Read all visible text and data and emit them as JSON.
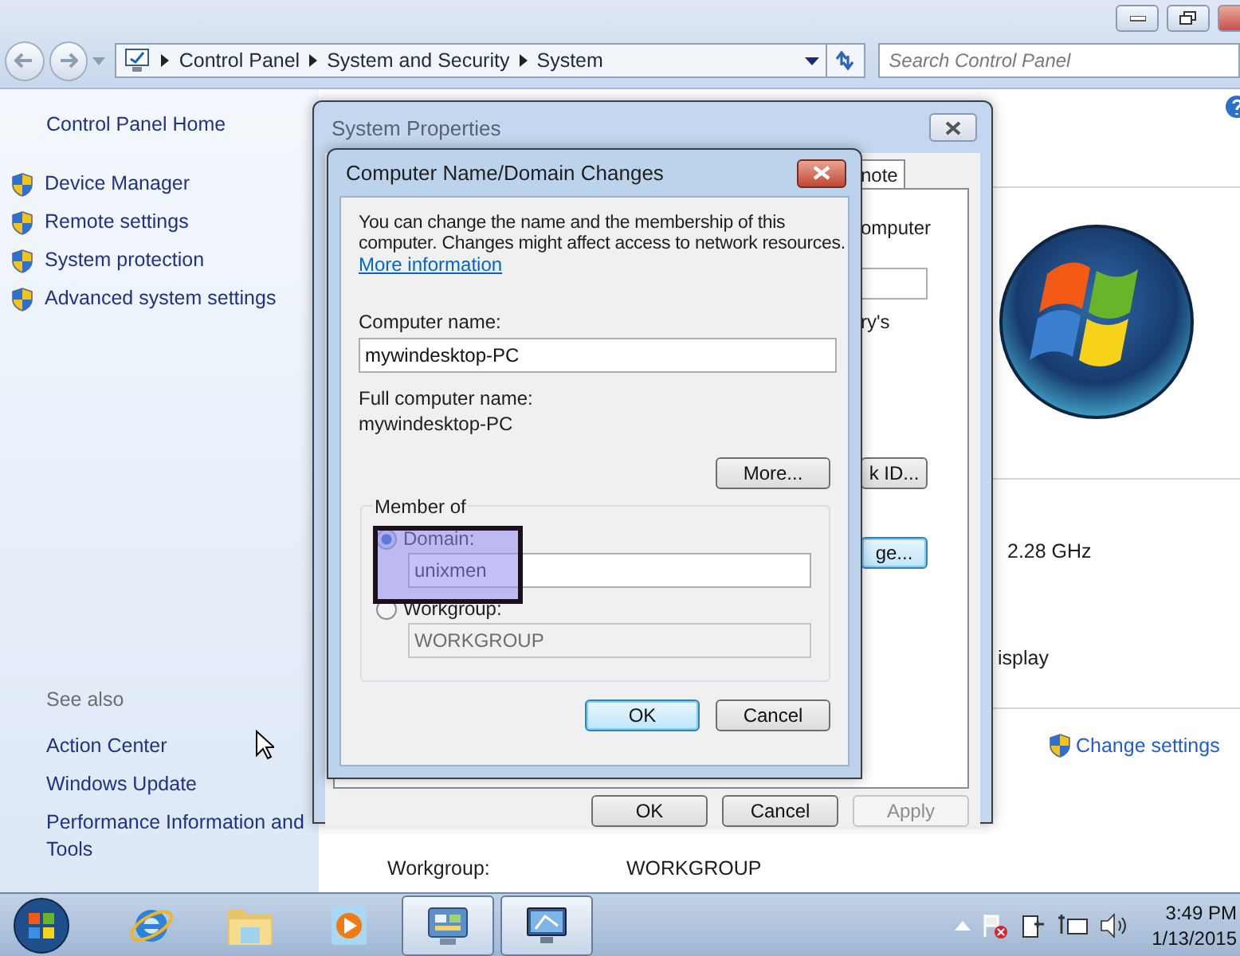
{
  "explorer": {
    "address_path": [
      "Control Panel",
      "System and Security",
      "System"
    ],
    "search": {
      "placeholder": "Search Control Panel"
    }
  },
  "sidebar": {
    "home": "Control Panel Home",
    "tasks": [
      "Device Manager",
      "Remote settings",
      "System protection",
      "Advanced system settings"
    ],
    "see_also_title": "See also",
    "see_also": [
      "Action Center",
      "Windows Update",
      "Performance Information and Tools"
    ]
  },
  "content": {
    "processor_speed": "2.28 GHz",
    "display_fragment": "isplay",
    "change_settings": "Change settings",
    "workgroup_label": "Workgroup:",
    "workgroup_value": "WORKGROUP"
  },
  "system_properties": {
    "title": "System Properties",
    "tab_fragment": "note",
    "text_fragments": [
      "omputer",
      "ry's"
    ],
    "panel_buttons": [
      {
        "label": "k ID...",
        "default": false
      },
      {
        "label": "ge...",
        "default": true
      }
    ],
    "footer_buttons": [
      {
        "label": "OK",
        "disabled": false
      },
      {
        "label": "Cancel",
        "disabled": false
      },
      {
        "label": "Apply",
        "disabled": true
      }
    ]
  },
  "name_dialog": {
    "title": "Computer Name/Domain Changes",
    "description": "You can change the name and the membership of this computer. Changes might affect access to network resources.",
    "link": "More information",
    "computer_name_label": "Computer name:",
    "computer_name": "mywindesktop-PC",
    "full_name_label": "Full computer name:",
    "full_name": "mywindesktop-PC",
    "more_button": "More...",
    "member_of": "Member of",
    "options": [
      {
        "label": "Domain:",
        "selected": true,
        "value": "unixmen",
        "disabled": false
      },
      {
        "label": "Workgroup:",
        "selected": false,
        "value": "WORKGROUP",
        "disabled": true
      }
    ],
    "buttons": [
      {
        "label": "OK",
        "default": true
      },
      {
        "label": "Cancel",
        "default": false
      }
    ]
  },
  "taskbar": {
    "apps": [
      {
        "kind": "browser",
        "active": false
      },
      {
        "kind": "folder",
        "active": false
      },
      {
        "kind": "media",
        "active": false
      },
      {
        "kind": "control-panel",
        "active": true
      },
      {
        "kind": "remote-desktop",
        "active": true
      }
    ],
    "clock": {
      "time": "3:49 PM",
      "date": "1/13/2015"
    }
  }
}
